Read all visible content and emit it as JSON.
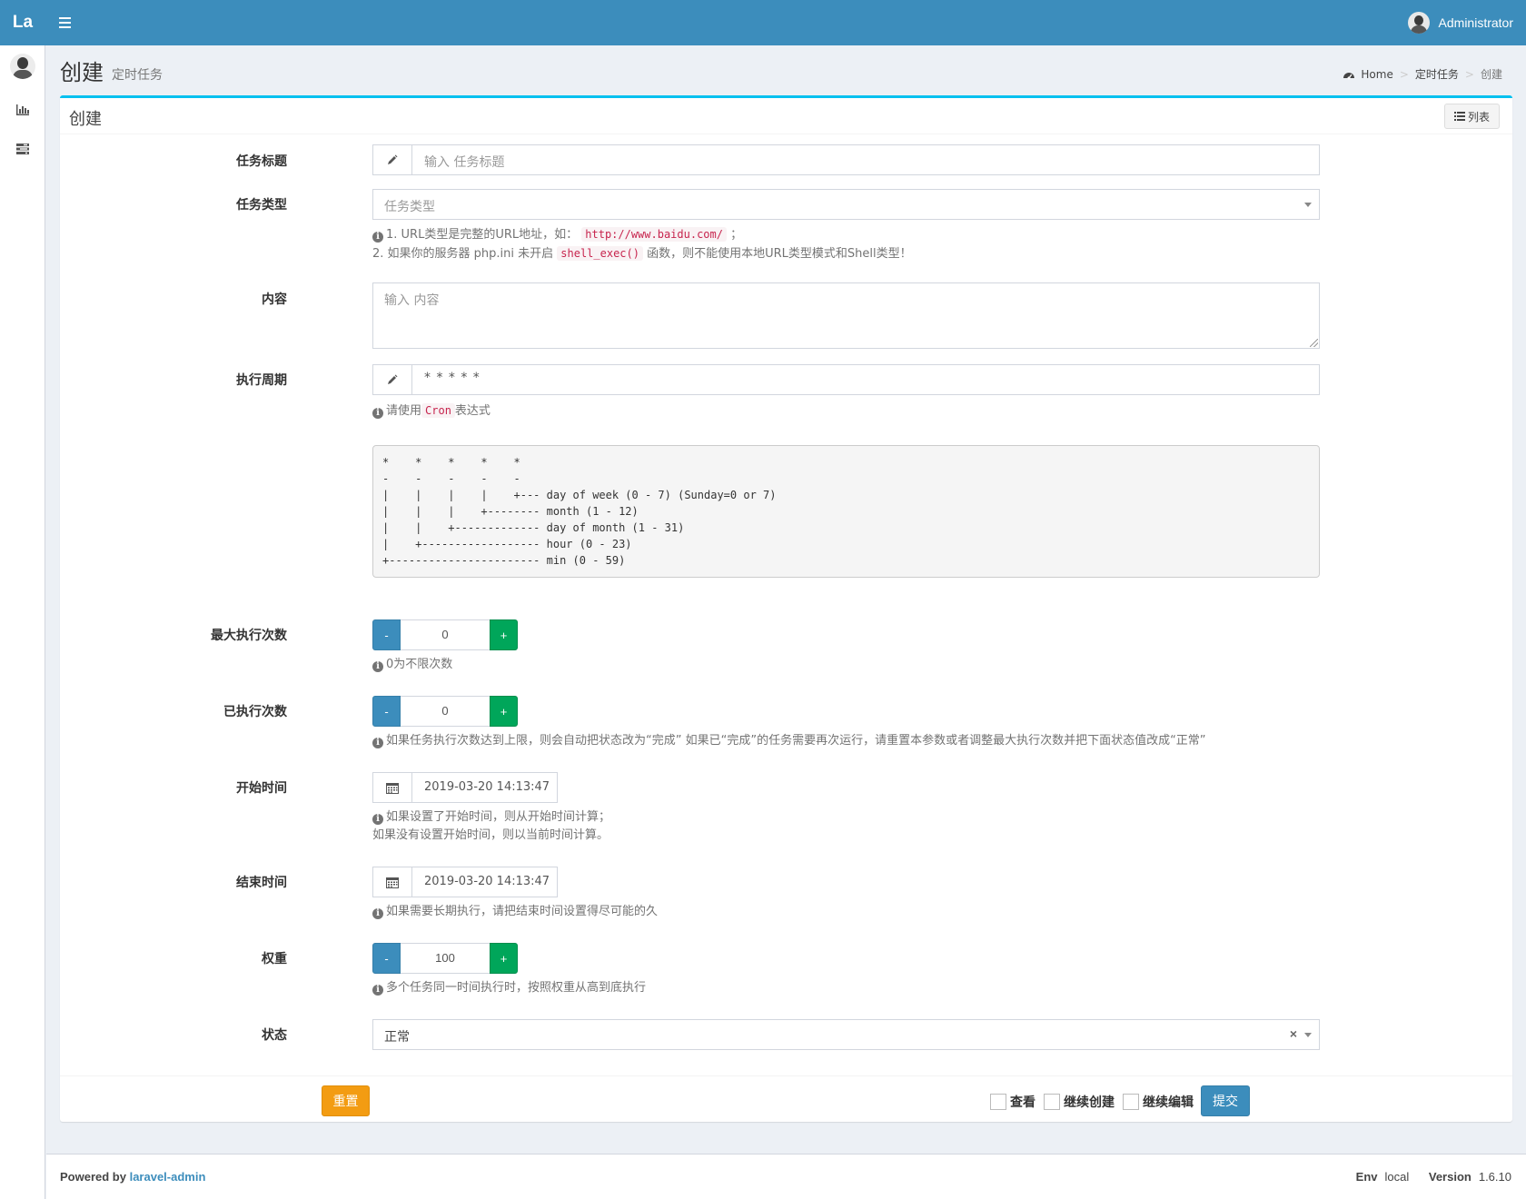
{
  "header": {
    "logo": "La",
    "user_name": "Administrator"
  },
  "page": {
    "title": "创建",
    "subtitle": "定时任务"
  },
  "breadcrumb": {
    "home": "Home",
    "section": "定时任务",
    "current": "创建"
  },
  "box": {
    "title": "创建",
    "list_button": "列表"
  },
  "form": {
    "title_label": "任务标题",
    "title_placeholder": "输入 任务标题",
    "type_label": "任务类型",
    "type_placeholder": "任务类型",
    "type_help_1_prefix": "1. URL类型是完整的URL地址，如：",
    "type_help_1_code": "http://www.baidu.com/",
    "type_help_1_suffix": "；",
    "type_help_2_prefix": "2. 如果你的服务器 php.ini 未开启",
    "type_help_2_code": "shell_exec()",
    "type_help_2_suffix": "函数，则不能使用本地URL类型模式和Shell类型！",
    "content_label": "内容",
    "content_placeholder": "输入 内容",
    "cycle_label": "执行周期",
    "cycle_value": "* * * * *",
    "cycle_help_prefix": "请使用",
    "cycle_help_code": "Cron",
    "cycle_help_suffix": "表达式",
    "cron_diagram": "*    *    *    *    *\n-    -    -    -    -\n|    |    |    |    +--- day of week (0 - 7) (Sunday=0 or 7)\n|    |    |    +-------- month (1 - 12)\n|    |    +------------- day of month (1 - 31)\n|    +------------------ hour (0 - 23)\n+----------------------- min (0 - 59)",
    "max_runs_label": "最大执行次数",
    "max_runs_value": "0",
    "max_runs_help": "0为不限次数",
    "runs_label": "已执行次数",
    "runs_value": "0",
    "runs_help": "如果任务执行次数达到上限，则会自动把状态改为“完成” 如果已“完成”的任务需要再次运行，请重置本参数或者调整最大执行次数并把下面状态值改成“正常”",
    "start_label": "开始时间",
    "start_value": "2019-03-20 14:13:47",
    "start_help_1": "如果设置了开始时间，则从开始时间计算；",
    "start_help_2": "如果没有设置开始时间，则以当前时间计算。",
    "end_label": "结束时间",
    "end_value": "2019-03-20 14:13:47",
    "end_help": "如果需要长期执行，请把结束时间设置得尽可能的久",
    "weight_label": "权重",
    "weight_value": "100",
    "weight_help": "多个任务同一时间执行时，按照权重从高到底执行",
    "status_label": "状态",
    "status_value": "正常",
    "stepper_minus": "-",
    "stepper_plus": "+"
  },
  "actions": {
    "reset": "重置",
    "view": "查看",
    "continue_create": "继续创建",
    "continue_edit": "继续编辑",
    "submit": "提交"
  },
  "footer": {
    "powered_by": "Powered by",
    "link": "laravel-admin",
    "env_label": "Env",
    "env_value": "local",
    "version_label": "Version",
    "version_value": "1.6.10"
  },
  "colors": {
    "primary": "#3c8dbc",
    "success": "#00a65a",
    "warning": "#f39c12",
    "box_accent": "#00c0ef"
  }
}
